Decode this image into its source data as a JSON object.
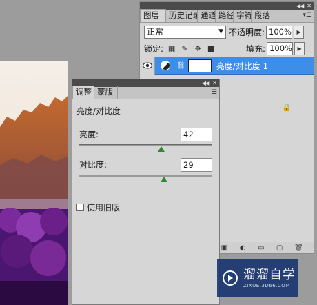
{
  "layers_panel": {
    "tabs": [
      "图层",
      "历史记录",
      "通道",
      "路径",
      "字符",
      "段落"
    ],
    "blend_mode": "正常",
    "opacity_label": "不透明度:",
    "opacity_value": "100%",
    "lock_label": "锁定:",
    "fill_label": "填充:",
    "fill_value": "100%",
    "layer_name": "亮度/对比度 1"
  },
  "adjustments_panel": {
    "tabs": [
      "调整",
      "蒙版"
    ],
    "title": "亮度/对比度",
    "brightness": {
      "label": "亮度:",
      "value": "42",
      "level": 0.62
    },
    "contrast": {
      "label": "对比度:",
      "value": "29",
      "level": 0.64
    },
    "legacy_label": "使用旧版"
  },
  "watermark": {
    "name": "溜溜自学",
    "url": "ZIXUE.3D66.COM"
  },
  "colors": {
    "selected_layer": "#3c8ee8",
    "panel_bg": "#d6d6d6",
    "slider_thumb": "#2e8a2e"
  }
}
